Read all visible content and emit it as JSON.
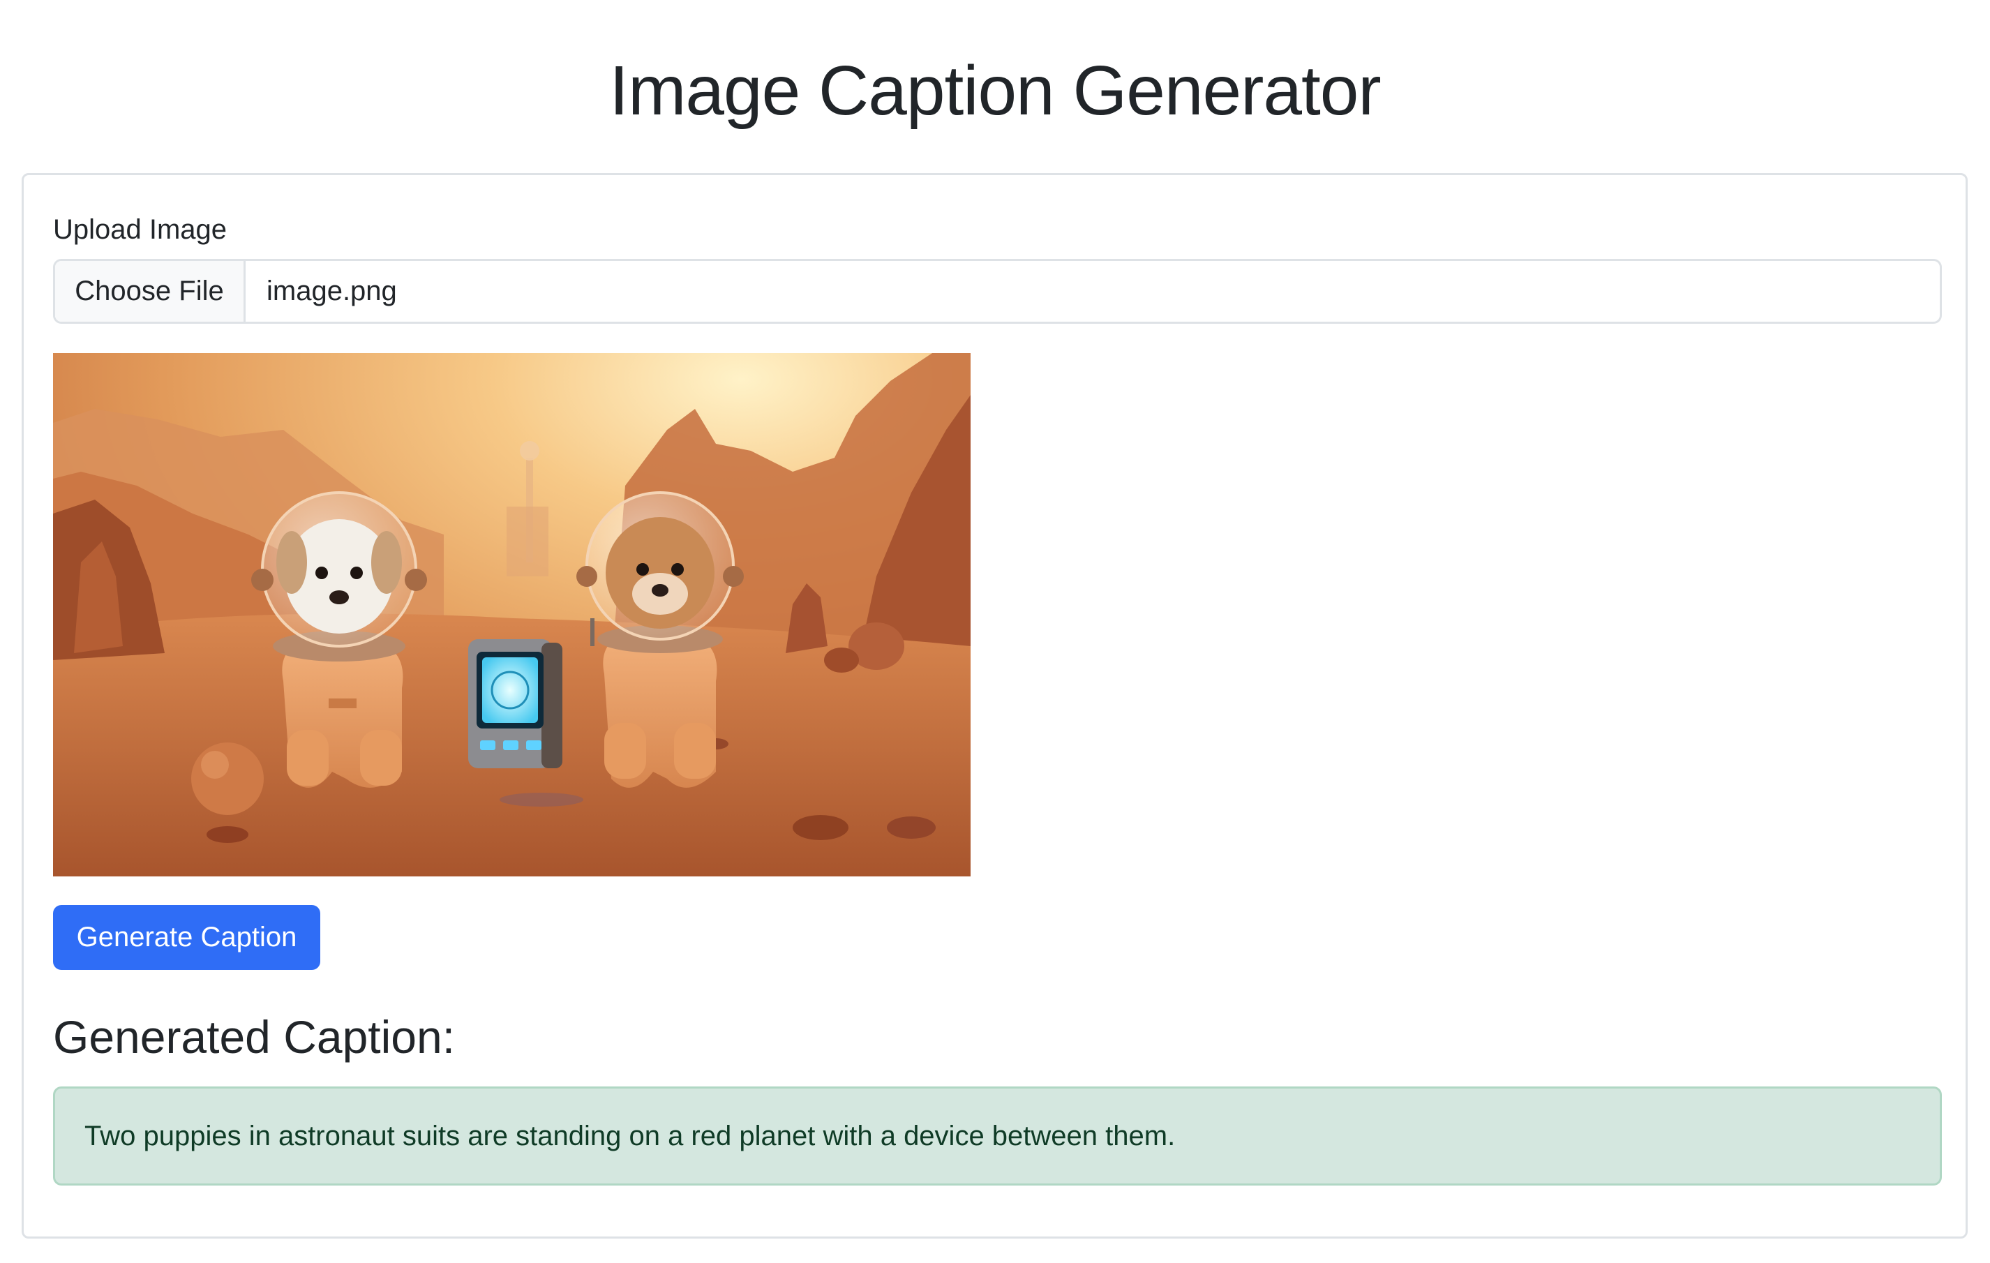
{
  "page": {
    "title": "Image Caption Generator"
  },
  "upload": {
    "label": "Upload Image",
    "button_label": "Choose File",
    "file_name": "image.png"
  },
  "actions": {
    "generate_label": "Generate Caption"
  },
  "result": {
    "heading": "Generated Caption:",
    "caption": "Two puppies in astronaut suits are standing on a red planet with a device between them."
  },
  "colors": {
    "primary_button": "#2f6df6",
    "caption_background": "#d4e7df",
    "caption_text": "#0f3b26",
    "border": "#dee2e6"
  }
}
